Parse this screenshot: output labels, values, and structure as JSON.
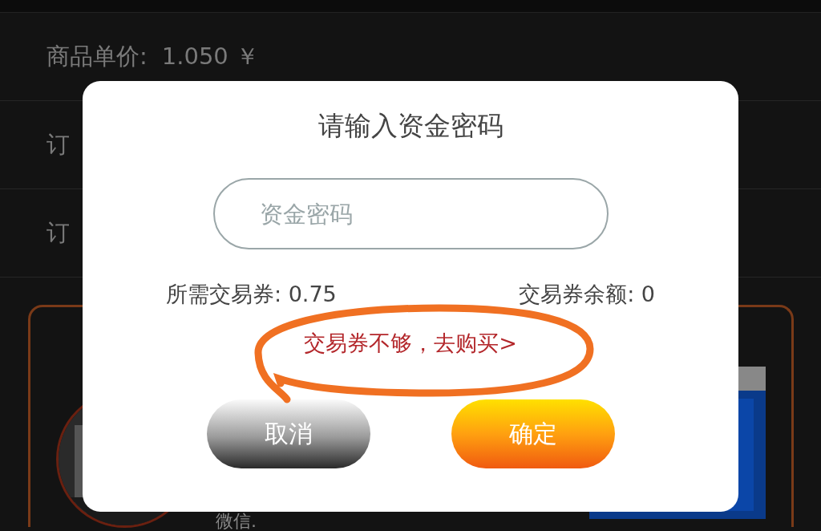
{
  "background": {
    "rows": [
      {
        "label": "商品单价:",
        "value": "1.050 ￥"
      },
      {
        "label": "订"
      },
      {
        "label": "订"
      }
    ],
    "card": {
      "text": "微信."
    }
  },
  "dialog": {
    "title": "请输入资金密码",
    "password_field": {
      "placeholder": "资金密码"
    },
    "required": "所需交易券: 0.75",
    "balance": "交易券余额: 0",
    "buy_link": "交易券不够，去购买>",
    "buttons": [
      {
        "kind": "cancel",
        "label": "取消"
      },
      {
        "kind": "confirm",
        "label": "确定"
      }
    ]
  },
  "annotation": {
    "kind": "scribble-circle",
    "color": "#f07022"
  }
}
